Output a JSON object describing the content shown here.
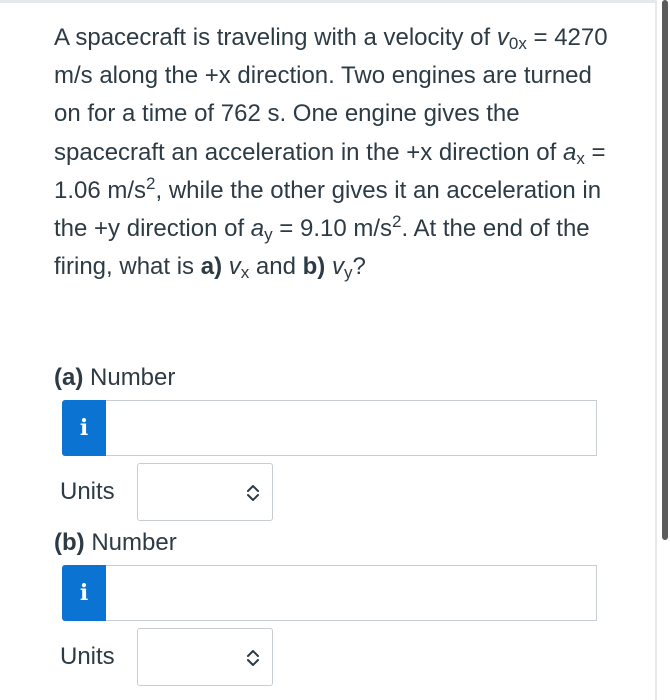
{
  "question": {
    "p1": "A spacecraft is traveling with a velocity of ",
    "v": "v",
    "v_sub": "0x",
    "p2": " = 4270 m/s along the +x direction. Two engines are turned on for a time of 762 s. One engine gives the spacecraft an acceleration in the +x direction of ",
    "ax": "a",
    "ax_sub": "x",
    "p3": " = 1.06 m/s",
    "p3_sup": "2",
    "p4": ", while the other gives it an acceleration in the +y direction of ",
    "ay": "a",
    "ay_sub": "y",
    "p5": " = 9.10 m/s",
    "p5_sup": "2",
    "p6": ". At the end of the firing, what is ",
    "a_bold": "a)",
    "space1": " ",
    "vx": "v",
    "vx_sub": "x",
    "and": " and ",
    "b_bold": "b)",
    "space2": " ",
    "vy": "v",
    "vy_sub": "y",
    "q": "?"
  },
  "part_a": {
    "label_bold": "(a)",
    "label_rest": " Number",
    "info_glyph": "i",
    "number_value": "",
    "units_label": "Units",
    "units_value": ""
  },
  "part_b": {
    "label_bold": "(b)",
    "label_rest": " Number",
    "info_glyph": "i",
    "number_value": "",
    "units_label": "Units",
    "units_value": ""
  },
  "colors": {
    "info_button": "#0b74d3",
    "text": "#2d3b45",
    "border": "#c7cdd1"
  },
  "icons": {
    "info": "info-icon",
    "select": "chevron-up-down-icon"
  }
}
